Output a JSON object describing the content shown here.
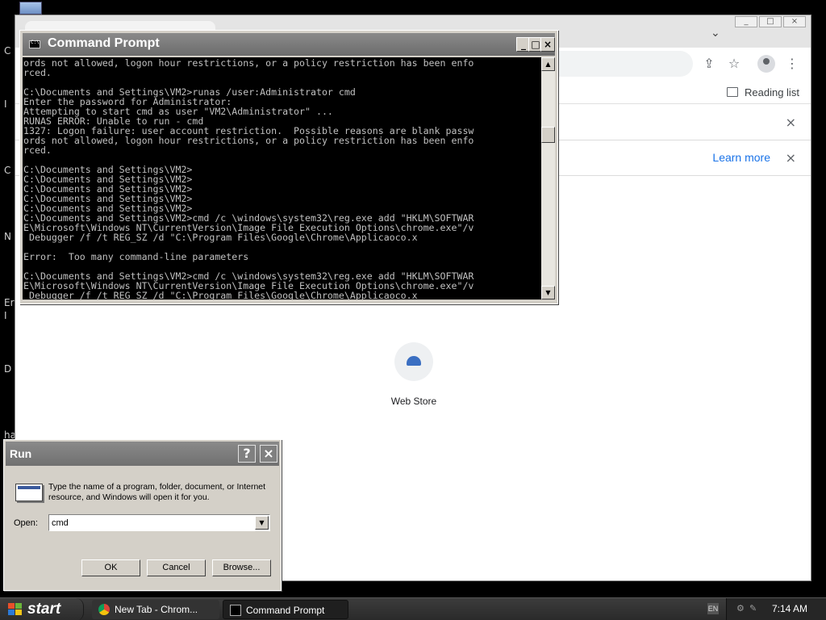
{
  "desktop": {
    "edge_letters": [
      "C",
      "I",
      "C",
      "N",
      "Er",
      "I",
      "D",
      "ha"
    ]
  },
  "chrome": {
    "window_controls": [
      "_",
      "□",
      "×"
    ],
    "tab_chevron": "⌄",
    "bookmarks": {
      "reading_list": "Reading list"
    },
    "infobar1": {
      "close": "×"
    },
    "infobar2": {
      "learn_more": "Learn more",
      "close": "×"
    },
    "shortcut": {
      "label": "Web Store"
    }
  },
  "cmd": {
    "title": "Command Prompt",
    "controls": {
      "minimize": "_",
      "maximize": "□",
      "close": "×"
    },
    "lines": [
      "ords not allowed, logon hour restrictions, or a policy restriction has been enfo",
      "rced.",
      "",
      "C:\\Documents and Settings\\VM2>runas /user:Administrator cmd",
      "Enter the password for Administrator:",
      "Attempting to start cmd as user \"VM2\\Administrator\" ...",
      "RUNAS ERROR: Unable to run - cmd",
      "1327: Logon failure: user account restriction.  Possible reasons are blank passw",
      "ords not allowed, logon hour restrictions, or a policy restriction has been enfo",
      "rced.",
      "",
      "C:\\Documents and Settings\\VM2>",
      "C:\\Documents and Settings\\VM2>",
      "C:\\Documents and Settings\\VM2>",
      "C:\\Documents and Settings\\VM2>",
      "C:\\Documents and Settings\\VM2>",
      "C:\\Documents and Settings\\VM2>cmd /c \\windows\\system32\\reg.exe add \"HKLM\\SOFTWAR",
      "E\\Microsoft\\Windows NT\\CurrentVersion\\Image File Execution Options\\chrome.exe\"/v",
      " Debugger /f /t REG_SZ /d \"C:\\Program Files\\Google\\Chrome\\Applicaoco.x",
      "",
      "Error:  Too many command-line parameters",
      "",
      "C:\\Documents and Settings\\VM2>cmd /c \\windows\\system32\\reg.exe add \"HKLM\\SOFTWAR",
      "E\\Microsoft\\Windows NT\\CurrentVersion\\Image File Execution Options\\chrome.exe\"/v",
      " Debugger /f /t REG_SZ /d \"C:\\Program Files\\Google\\Chrome\\Applicaoco.x"
    ],
    "scroll": {
      "up": "▲",
      "down": "▼"
    }
  },
  "run": {
    "title": "Run",
    "help": "?",
    "close": "×",
    "description": "Type the name of a program, folder, document, or Internet resource, and Windows will open it for you.",
    "open_label": "Open:",
    "open_value": "cmd",
    "dropdown_arrow": "▼",
    "ok": "OK",
    "cancel": "Cancel",
    "browse": "Browse..."
  },
  "taskbar": {
    "start": "start",
    "items": [
      {
        "label": "New Tab - Chrom..."
      },
      {
        "label": "Command Prompt"
      }
    ],
    "lang": "EN",
    "clock": "7:14 AM"
  }
}
